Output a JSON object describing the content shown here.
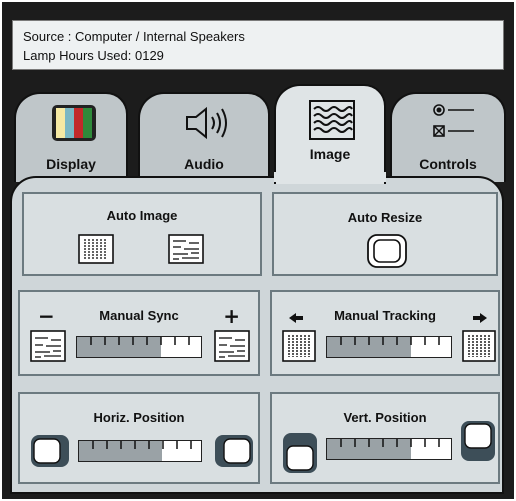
{
  "info": {
    "source": "Source : Computer / Internal Speakers",
    "lamp": "Lamp Hours Used: 0129"
  },
  "tabs": [
    {
      "label": "Display",
      "icon": "color-bars-icon"
    },
    {
      "label": "Audio",
      "icon": "speaker-icon"
    },
    {
      "label": "Image",
      "icon": "wavy-lines-icon",
      "active": true
    },
    {
      "label": "Controls",
      "icon": "controls-icon"
    }
  ],
  "controls": {
    "auto_image": "Auto Image",
    "auto_resize": "Auto  Resize",
    "manual_sync": "Manual Sync",
    "manual_tracking": "Manual Tracking",
    "horiz_position": "Horiz. Position",
    "vert_position": "Vert. Position",
    "minus": "−",
    "plus": "+"
  },
  "sliders": {
    "manual_sync": 0.68,
    "manual_tracking": 0.68,
    "horiz_position": 0.68,
    "vert_position": 0.68
  },
  "colors": {
    "frame": "#1c1c1c",
    "tab": "#bfc6c9",
    "active_tab": "#dfe4e6",
    "panel": "#cfd6d9",
    "box": "#d9dfe1",
    "slider_fill": "#9aa2a6",
    "display_bars": [
      "#f5e9a3",
      "#7ab7c4",
      "#c12a2a",
      "#2f8a3a"
    ]
  }
}
